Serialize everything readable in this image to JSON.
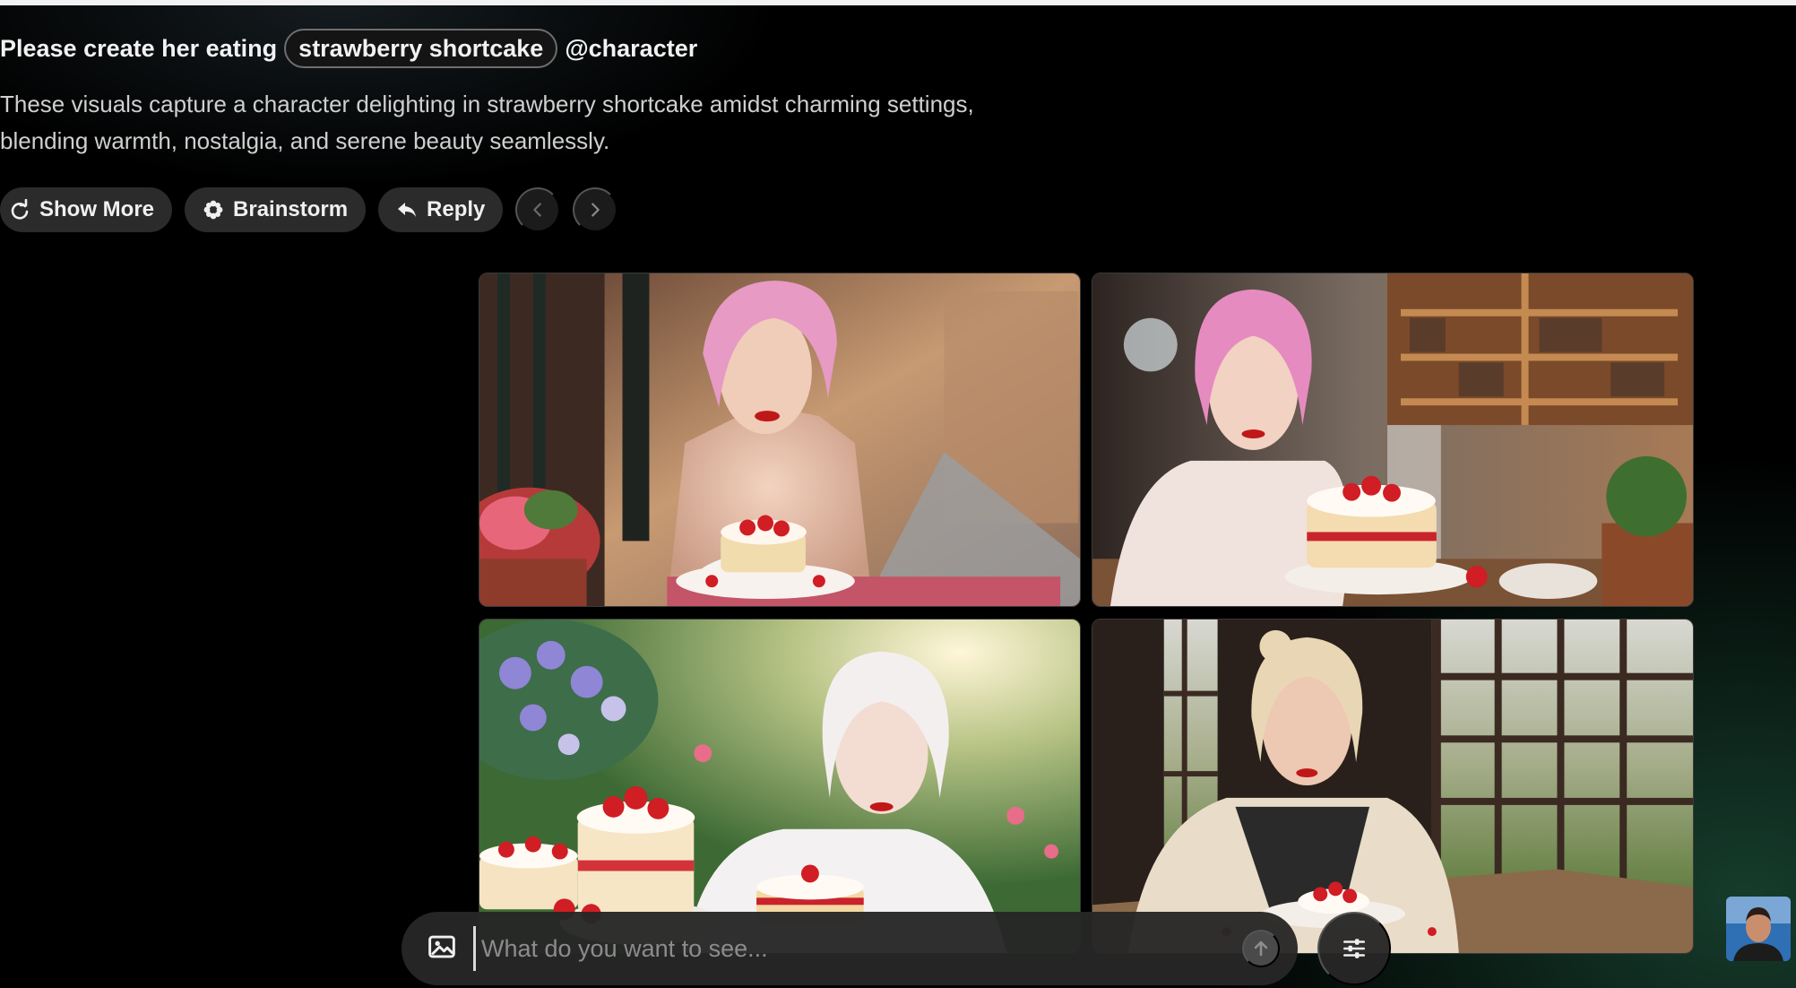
{
  "prompt": {
    "prefix": "Please create her eating",
    "chip": "strawberry shortcake",
    "mention": "@character"
  },
  "description": "These visuals capture a character delighting in strawberry shortcake amidst charming settings, blending warmth, nostalgia, and serene beauty seamlessly.",
  "actions": {
    "show_more": "Show More",
    "brainstorm": "Brainstorm",
    "reply": "Reply"
  },
  "icons": {
    "show_more": "refresh-icon",
    "brainstorm": "flower-icon",
    "reply": "reply-icon",
    "prev": "chevron-left-icon",
    "next": "chevron-right-icon",
    "attach": "image-icon",
    "send": "arrow-up-icon",
    "settings": "sliders-icon"
  },
  "composer": {
    "placeholder": "What do you want to see..."
  },
  "colors": {
    "background": "#000000",
    "pill": "#2b2b2b",
    "glow": "#286e50"
  }
}
